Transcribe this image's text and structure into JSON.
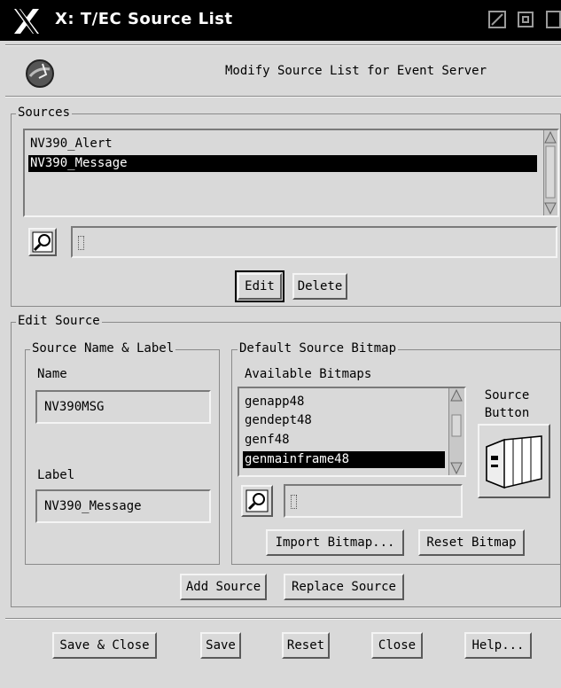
{
  "window": {
    "title": "X: T/EC Source List",
    "header_text": "Modify Source List for Event Server"
  },
  "sources": {
    "group_title": "Sources",
    "items": [
      "NV390_Alert",
      "NV390_Message"
    ],
    "selected_index": 1,
    "filter_value": "",
    "edit_label": "Edit",
    "delete_label": "Delete"
  },
  "edit_source": {
    "group_title": "Edit Source",
    "name_label_group": "Source Name & Label",
    "name_label": "Name",
    "name_value": "NV390MSG",
    "label_label": "Label",
    "label_value": "NV390_Message",
    "bitmap_group": "Default Source Bitmap",
    "available_label": "Available Bitmaps",
    "bitmaps": [
      "genapp48",
      "gendept48",
      "genf48",
      "genmainframe48"
    ],
    "selected_bitmap_index": 3,
    "bitmap_filter_value": "",
    "source_button_label_1": "Source",
    "source_button_label_2": "Button",
    "import_label": "Import Bitmap...",
    "reset_bitmap_label": "Reset Bitmap",
    "add_source_label": "Add Source",
    "replace_source_label": "Replace Source"
  },
  "footer": {
    "save_close": "Save & Close",
    "save": "Save",
    "reset": "Reset",
    "close": "Close",
    "help": "Help..."
  },
  "colors": {
    "background": "#d9d9d9",
    "selection": "#000000",
    "titlebar": "#000000"
  }
}
